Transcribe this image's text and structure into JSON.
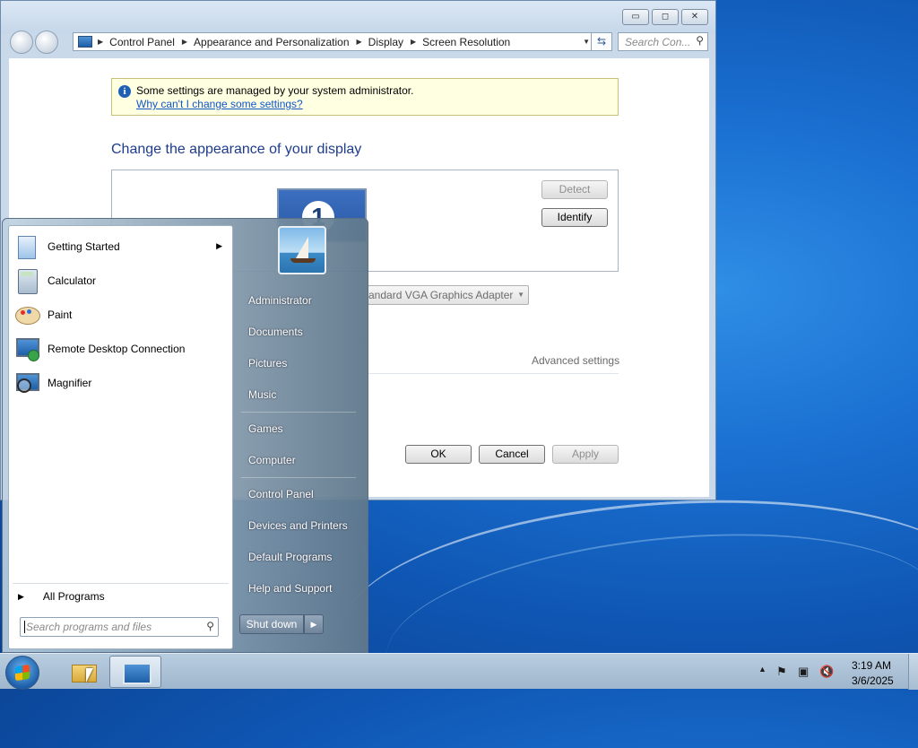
{
  "window": {
    "controls": {
      "minimize": "▭",
      "maximize": "◻",
      "close": "✕"
    },
    "breadcrumbs": [
      "Control Panel",
      "Appearance and Personalization",
      "Display",
      "Screen Resolution"
    ],
    "search_placeholder": "Search Con...",
    "info_text": "Some settings are managed by your system administrator.",
    "info_link": "Why can't I change some settings?",
    "heading": "Change the appearance of your display",
    "monitor_number": "1",
    "detect_label": "Detect",
    "identify_label": "Identify",
    "adapter_value": "andard VGA Graphics Adapter",
    "advanced_link": "Advanced settings",
    "ok_label": "OK",
    "cancel_label": "Cancel",
    "apply_label": "Apply"
  },
  "start_menu": {
    "programs": [
      {
        "label": "Getting Started",
        "icon": "getting-started-icon",
        "has_submenu": true
      },
      {
        "label": "Calculator",
        "icon": "calculator-icon"
      },
      {
        "label": "Paint",
        "icon": "paint-icon"
      },
      {
        "label": "Remote Desktop Connection",
        "icon": "remote-desktop-icon"
      },
      {
        "label": "Magnifier",
        "icon": "magnifier-icon"
      }
    ],
    "all_programs": "All Programs",
    "search_placeholder": "Search programs and files",
    "right_items": [
      "Administrator",
      "Documents",
      "Pictures",
      "Music",
      "Games",
      "Computer",
      "Control Panel",
      "Devices and Printers",
      "Default Programs",
      "Help and Support"
    ],
    "shutdown_label": "Shut down"
  },
  "taskbar": {
    "time": "3:19 AM",
    "date": "3/6/2025"
  },
  "colors": {
    "heading": "#1e3c8c",
    "link": "#1155cc",
    "info_bg": "#ffffe1",
    "desktop": "#1a6fd0"
  }
}
